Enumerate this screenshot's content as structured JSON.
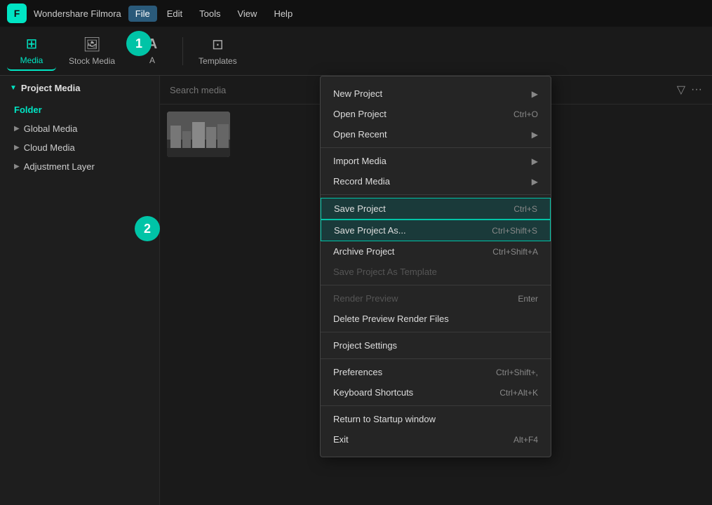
{
  "app": {
    "logo": "F",
    "title": "Wondershare Filmora",
    "menu": [
      "File",
      "Edit",
      "Tools",
      "View",
      "Help"
    ],
    "active_menu": "File"
  },
  "toolbar": {
    "tabs": [
      {
        "label": "Media",
        "icon": "⊞",
        "active": true
      },
      {
        "label": "Stock Media",
        "icon": "🖼",
        "active": false
      },
      {
        "label": "A",
        "icon": "A",
        "active": false
      },
      {
        "label": "Templates",
        "icon": "⊡",
        "active": false
      }
    ]
  },
  "badges": [
    {
      "number": "1",
      "class": "badge-1"
    },
    {
      "number": "2",
      "class": "badge-2"
    }
  ],
  "sidebar": {
    "header": "Project Media",
    "folder_label": "Folder",
    "items": [
      {
        "label": "Global Media"
      },
      {
        "label": "Cloud Media"
      },
      {
        "label": "Adjustment Layer"
      }
    ]
  },
  "search": {
    "placeholder": "Search media"
  },
  "dropdown": {
    "sections": [
      {
        "items": [
          {
            "label": "New Project",
            "shortcut": "",
            "has_arrow": true,
            "state": "normal"
          },
          {
            "label": "Open Project",
            "shortcut": "Ctrl+O",
            "has_arrow": false,
            "state": "normal"
          },
          {
            "label": "Open Recent",
            "shortcut": "",
            "has_arrow": true,
            "state": "normal"
          }
        ]
      },
      {
        "items": [
          {
            "label": "Import Media",
            "shortcut": "",
            "has_arrow": true,
            "state": "normal"
          },
          {
            "label": "Record Media",
            "shortcut": "",
            "has_arrow": true,
            "state": "normal"
          }
        ]
      },
      {
        "items": [
          {
            "label": "Save Project",
            "shortcut": "Ctrl+S",
            "has_arrow": false,
            "state": "highlighted"
          },
          {
            "label": "Save Project As...",
            "shortcut": "Ctrl+Shift+S",
            "has_arrow": false,
            "state": "highlighted"
          },
          {
            "label": "Archive Project",
            "shortcut": "Ctrl+Shift+A",
            "has_arrow": false,
            "state": "normal"
          },
          {
            "label": "Save Project As Template",
            "shortcut": "",
            "has_arrow": false,
            "state": "disabled"
          }
        ]
      },
      {
        "items": [
          {
            "label": "Render Preview",
            "shortcut": "Enter",
            "has_arrow": false,
            "state": "disabled"
          },
          {
            "label": "Delete Preview Render Files",
            "shortcut": "",
            "has_arrow": false,
            "state": "normal"
          }
        ]
      },
      {
        "items": [
          {
            "label": "Project Settings",
            "shortcut": "",
            "has_arrow": false,
            "state": "normal"
          }
        ]
      },
      {
        "items": [
          {
            "label": "Preferences",
            "shortcut": "Ctrl+Shift+,",
            "has_arrow": false,
            "state": "normal"
          },
          {
            "label": "Keyboard Shortcuts",
            "shortcut": "Ctrl+Alt+K",
            "has_arrow": false,
            "state": "normal"
          }
        ]
      },
      {
        "items": [
          {
            "label": "Return to Startup window",
            "shortcut": "",
            "has_arrow": false,
            "state": "normal"
          },
          {
            "label": "Exit",
            "shortcut": "Alt+F4",
            "has_arrow": false,
            "state": "normal"
          }
        ]
      }
    ]
  }
}
